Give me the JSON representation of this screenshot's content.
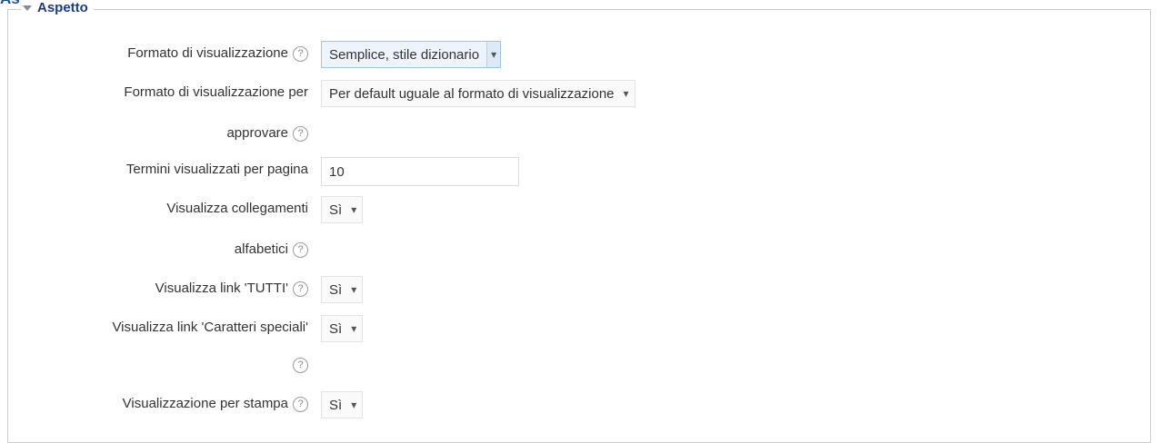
{
  "header_fragment": "Aspetto",
  "section": {
    "title": "Aspetto"
  },
  "help_icon_glyph": "?",
  "fields": {
    "display_format": {
      "label": "Formato di visualizzazione",
      "value": "Semplice, stile dizionario"
    },
    "approval_format": {
      "label_line1": "Formato di visualizzazione per",
      "label_line2": "approvare",
      "value": "Per default uguale al formato di visualizzazione"
    },
    "entries_per_page": {
      "label": "Termini visualizzati per pagina",
      "value": "10"
    },
    "show_alphabet": {
      "label_line1": "Visualizza collegamenti",
      "label_line2": "alfabetici",
      "value": "Sì"
    },
    "show_all": {
      "label": "Visualizza link 'TUTTI'",
      "value": "Sì"
    },
    "show_special": {
      "label": "Visualizza link 'Caratteri speciali'",
      "value": "Sì"
    },
    "print_view": {
      "label": "Visualizzazione per stampa",
      "value": "Sì"
    }
  },
  "icons": {
    "collapse": "triangle-down-icon",
    "help": "help-icon",
    "dropdown": "dropdown-arrow-icon"
  }
}
